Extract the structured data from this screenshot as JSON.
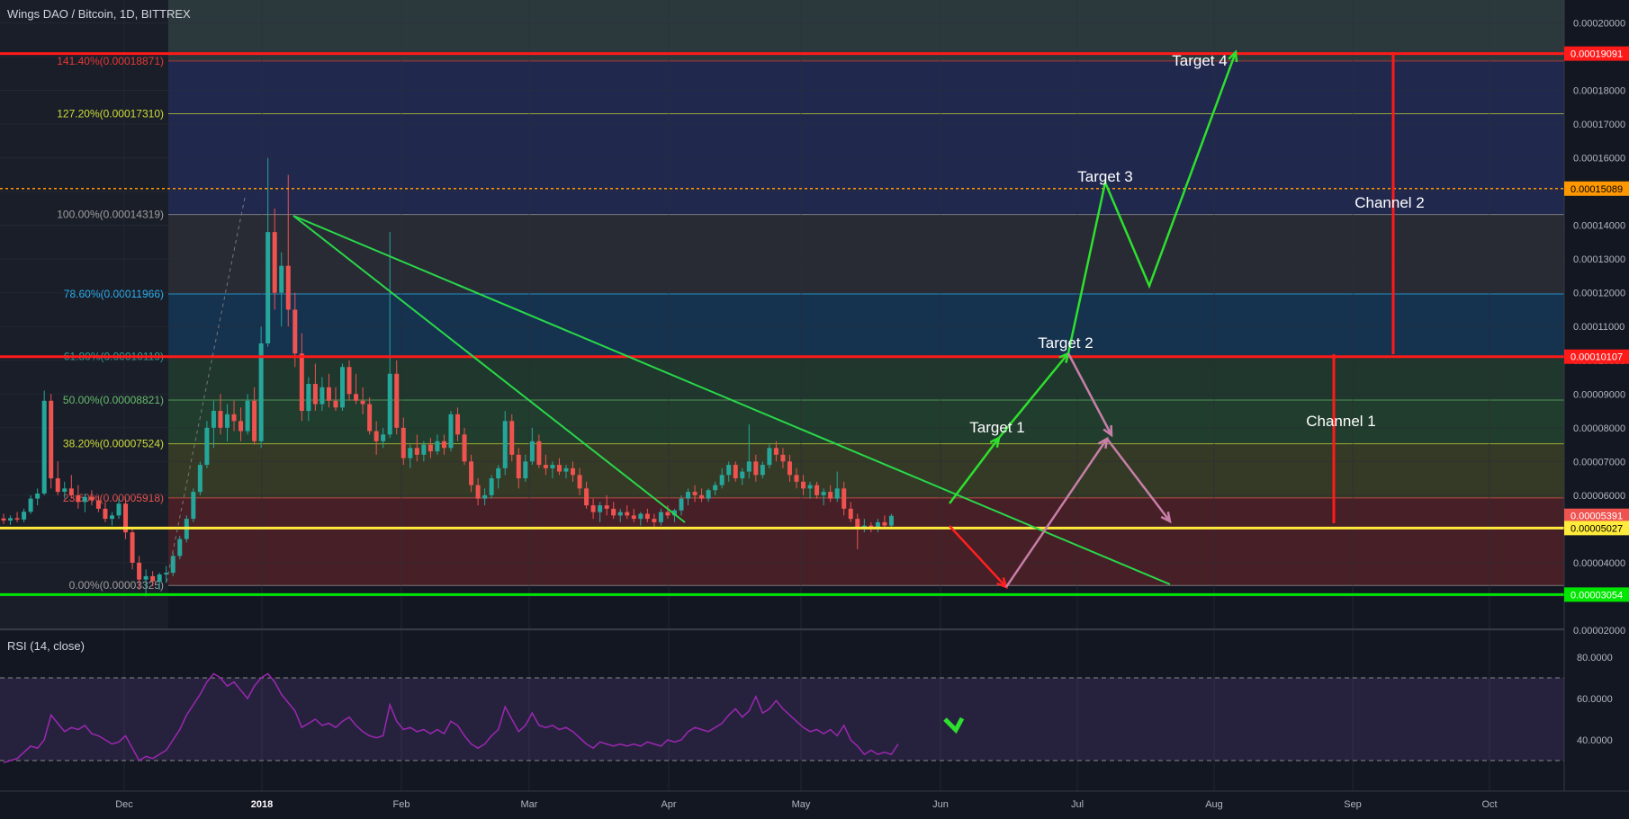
{
  "header": {
    "symbol_title": "Wings DAO / Bitcoin, 1D, BITTREX"
  },
  "rsi": {
    "label": "RSI (14, close)",
    "ticks": [
      "80.0000",
      "60.0000",
      "40.0000"
    ]
  },
  "colors": {
    "background": "#131722",
    "up": "#26a69a",
    "down": "#ef5350",
    "rsi_line": "#9c27b0"
  },
  "chart_data": {
    "type": "candlestick",
    "x_axis": {
      "tick_labels": [
        "Dec",
        "2018",
        "Feb",
        "Mar",
        "Apr",
        "May",
        "Jun",
        "Jul",
        "Aug",
        "Sep",
        "Oct"
      ]
    },
    "y_axis": {
      "tick_labels": [
        "0.00020000",
        "0.00019000",
        "0.00018000",
        "0.00017000",
        "0.00016000",
        "0.00015000",
        "0.00014000",
        "0.00013000",
        "0.00012000",
        "0.00011000",
        "0.00010000",
        "0.00009000",
        "0.00008000",
        "0.00007000",
        "0.00006000",
        "0.00005000",
        "0.00004000",
        "0.00003000",
        "0.00002000"
      ],
      "range": [
        2e-05,
        0.000202
      ],
      "price_labels": [
        {
          "text": "0.00019091",
          "value": 0.00019091,
          "color": "#ff1a1a"
        },
        {
          "text": "0.00015089",
          "value": 0.00015089,
          "color": "#ff9800"
        },
        {
          "text": "0.00010107",
          "value": 0.00010107,
          "color": "#ff1a1a"
        },
        {
          "text": "0.00005391",
          "value": 5.391e-05,
          "color": "#ef5350"
        },
        {
          "text": "0.00005027",
          "value": 5.027e-05,
          "color": "#ffeb3b"
        },
        {
          "text": "0.00003054",
          "value": 3.054e-05,
          "color": "#00e600"
        }
      ]
    },
    "fib_levels": [
      {
        "label": "141.40%(0.00018871)",
        "value": 0.00018871,
        "color": "#e53935"
      },
      {
        "label": "127.20%(0.00017310)",
        "value": 0.0001731,
        "color": "#cddc39"
      },
      {
        "label": "100.00%(0.00014319)",
        "value": 0.00014319,
        "color": "#9e9e9e"
      },
      {
        "label": "78.60%(0.00011966)",
        "value": 0.00011966,
        "color": "#29b6f6"
      },
      {
        "label": "61.80%(0.00010119)",
        "value": 0.00010119,
        "color": "#26a69a"
      },
      {
        "label": "50.00%(0.00008821)",
        "value": 8.821e-05,
        "color": "#66bb6a"
      },
      {
        "label": "38.20%(0.00007524)",
        "value": 7.524e-05,
        "color": "#cddc39"
      },
      {
        "label": "23.60%(0.00005918)",
        "value": 5.918e-05,
        "color": "#ef5350"
      },
      {
        "label": "0.00%(0.00003325)",
        "value": 3.325e-05,
        "color": "#9e9e9e"
      }
    ],
    "annotations": [
      "Target 1",
      "Target 2",
      "Target 3",
      "Target 4",
      "Channel 1",
      "Channel 2"
    ],
    "horizontal_lines": [
      {
        "value": 0.00019091,
        "color": "#ff1a1a"
      },
      {
        "value": 0.00015089,
        "color": "#ff9800",
        "style": "dashed"
      },
      {
        "value": 0.00010107,
        "color": "#ff1a1a"
      },
      {
        "value": 5.027e-05,
        "color": "#ffeb3b"
      },
      {
        "value": 3.054e-05,
        "color": "#00e600"
      }
    ],
    "candles": [
      [
        5.31e-05,
        5.45e-05,
        5.15e-05,
        5.25e-05
      ],
      [
        5.25e-05,
        5.4e-05,
        5.12e-05,
        5.32e-05
      ],
      [
        5.32e-05,
        5.5e-05,
        5.2e-05,
        5.28e-05
      ],
      [
        5.28e-05,
        5.6e-05,
        5.2e-05,
        5.51e-05
      ],
      [
        5.51e-05,
        6e-05,
        5.45e-05,
        5.9e-05
      ],
      [
        5.9e-05,
        6.2e-05,
        5.7e-05,
        6.05e-05
      ],
      [
        6.05e-05,
        9.1e-05,
        6e-05,
        8.8e-05
      ],
      [
        8.8e-05,
        9e-05,
        6.2e-05,
        6.5e-05
      ],
      [
        6.5e-05,
        7e-05,
        6e-05,
        6.1e-05
      ],
      [
        6.1e-05,
        6.4e-05,
        5.9e-05,
        6.2e-05
      ],
      [
        6.2e-05,
        6.6e-05,
        5.9e-05,
        6e-05
      ],
      [
        6e-05,
        6.3e-05,
        5.6e-05,
        5.8e-05
      ],
      [
        5.8e-05,
        6.05e-05,
        5.5e-05,
        5.95e-05
      ],
      [
        5.95e-05,
        6.15e-05,
        5.7e-05,
        5.85e-05
      ],
      [
        5.85e-05,
        6e-05,
        5.5e-05,
        5.6e-05
      ],
      [
        5.6e-05,
        5.8e-05,
        5.2e-05,
        5.3e-05
      ],
      [
        5.3e-05,
        5.5e-05,
        5.1e-05,
        5.4e-05
      ],
      [
        5.4e-05,
        5.9e-05,
        5.3e-05,
        5.75e-05
      ],
      [
        5.75e-05,
        5.9e-05,
        4.7e-05,
        4.9e-05
      ],
      [
        4.9e-05,
        5e-05,
        3.8e-05,
        4e-05
      ],
      [
        4e-05,
        4.2e-05,
        3.2e-05,
        3.5e-05
      ],
      [
        3.5e-05,
        3.8e-05,
        3e-05,
        3.6e-05
      ],
      [
        3.6e-05,
        3.75e-05,
        3.3e-05,
        3.45e-05
      ],
      [
        3.45e-05,
        3.7e-05,
        3.2e-05,
        3.65e-05
      ],
      [
        3.65e-05,
        3.9e-05,
        3.4e-05,
        3.7e-05
      ],
      [
        3.7e-05,
        4.3e-05,
        3.6e-05,
        4.2e-05
      ],
      [
        4.2e-05,
        4.8e-05,
        4.1e-05,
        4.7e-05
      ],
      [
        4.7e-05,
        5.4e-05,
        4.6e-05,
        5.3e-05
      ],
      [
        5.3e-05,
        6.2e-05,
        5.2e-05,
        6.1e-05
      ],
      [
        6.1e-05,
        7e-05,
        6e-05,
        6.9e-05
      ],
      [
        6.9e-05,
        8.2e-05,
        6.8e-05,
        8e-05
      ],
      [
        8e-05,
        8.8e-05,
        7.4e-05,
        8.5e-05
      ],
      [
        8.5e-05,
        9e-05,
        7.8e-05,
        8e-05
      ],
      [
        8e-05,
        8.7e-05,
        7.6e-05,
        8.4e-05
      ],
      [
        8.4e-05,
        8.8e-05,
        7.9e-05,
        8.2e-05
      ],
      [
        8.2e-05,
        8.6e-05,
        7.6e-05,
        7.9e-05
      ],
      [
        7.9e-05,
        9e-05,
        7.8e-05,
        8.8e-05
      ],
      [
        8.8e-05,
        9.2e-05,
        7.5e-05,
        7.6e-05
      ],
      [
        7.6e-05,
        0.00011,
        7.4e-05,
        0.000105
      ],
      [
        0.000105,
        0.00016,
        0.000104,
        0.000138
      ],
      [
        0.000138,
        0.000145,
        0.000115,
        0.00012
      ],
      [
        0.00012,
        0.000132,
        0.00011,
        0.000128
      ],
      [
        0.000128,
        0.000155,
        0.00011,
        0.000115
      ],
      [
        0.000115,
        0.00012,
        9.8e-05,
        0.000102
      ],
      [
        0.000102,
        0.000108,
        8.2e-05,
        8.5e-05
      ],
      [
        8.5e-05,
        9.5e-05,
        8.2e-05,
        9.3e-05
      ],
      [
        9.3e-05,
        9.9e-05,
        8.5e-05,
        8.7e-05
      ],
      [
        8.7e-05,
        9.5e-05,
        8.5e-05,
        9.2e-05
      ],
      [
        9.2e-05,
        9.6e-05,
        8.6e-05,
        8.8e-05
      ],
      [
        8.8e-05,
        9.2e-05,
        8.5e-05,
        8.6e-05
      ],
      [
        8.6e-05,
        9.9e-05,
        8.5e-05,
        9.8e-05
      ],
      [
        9.8e-05,
        0.0001,
        8.8e-05,
        9e-05
      ],
      [
        9e-05,
        9.6e-05,
        8.7e-05,
        8.8e-05
      ],
      [
        8.8e-05,
        9.2e-05,
        8.4e-05,
        8.7e-05
      ],
      [
        8.7e-05,
        8.9e-05,
        7.8e-05,
        7.9e-05
      ],
      [
        7.9e-05,
        8.2e-05,
        7.2e-05,
        7.6e-05
      ],
      [
        7.6e-05,
        8e-05,
        7.4e-05,
        7.8e-05
      ],
      [
        7.8e-05,
        0.000138,
        7.7e-05,
        9.6e-05
      ],
      [
        9.6e-05,
        0.0001,
        7.8e-05,
        8e-05
      ],
      [
        8e-05,
        8.3e-05,
        6.9e-05,
        7.1e-05
      ],
      [
        7.1e-05,
        7.5e-05,
        6.8e-05,
        7.4e-05
      ],
      [
        7.4e-05,
        7.8e-05,
        7e-05,
        7.2e-05
      ],
      [
        7.2e-05,
        7.6e-05,
        7e-05,
        7.5e-05
      ],
      [
        7.5e-05,
        7.7e-05,
        7.1e-05,
        7.3e-05
      ],
      [
        7.3e-05,
        7.8e-05,
        7.2e-05,
        7.6e-05
      ],
      [
        7.6e-05,
        7.8e-05,
        7.2e-05,
        7.4e-05
      ],
      [
        7.4e-05,
        8.5e-05,
        7.3e-05,
        8.4e-05
      ],
      [
        8.4e-05,
        8.6e-05,
        7.6e-05,
        7.8e-05
      ],
      [
        7.8e-05,
        8e-05,
        6.9e-05,
        7e-05
      ],
      [
        7e-05,
        7.2e-05,
        6.1e-05,
        6.3e-05
      ],
      [
        6.3e-05,
        6.5e-05,
        5.7e-05,
        5.9e-05
      ],
      [
        5.9e-05,
        6.2e-05,
        5.7e-05,
        6e-05
      ],
      [
        6e-05,
        6.6e-05,
        5.9e-05,
        6.5e-05
      ],
      [
        6.5e-05,
        6.9e-05,
        6.2e-05,
        6.8e-05
      ],
      [
        6.8e-05,
        8.5e-05,
        6.6e-05,
        8.2e-05
      ],
      [
        8.2e-05,
        8.4e-05,
        7e-05,
        7.2e-05
      ],
      [
        7.2e-05,
        7.4e-05,
        6.2e-05,
        6.5e-05
      ],
      [
        6.5e-05,
        7.2e-05,
        6.4e-05,
        7e-05
      ],
      [
        7e-05,
        8e-05,
        6.9e-05,
        7.6e-05
      ],
      [
        7.6e-05,
        7.8e-05,
        6.8e-05,
        6.9e-05
      ],
      [
        6.9e-05,
        7.2e-05,
        6.6e-05,
        6.8e-05
      ],
      [
        6.8e-05,
        7e-05,
        6.5e-05,
        6.9e-05
      ],
      [
        6.9e-05,
        7.1e-05,
        6.6e-05,
        6.7e-05
      ],
      [
        6.7e-05,
        6.9e-05,
        6.5e-05,
        6.8e-05
      ],
      [
        6.8e-05,
        7e-05,
        6.4e-05,
        6.6e-05
      ],
      [
        6.6e-05,
        6.8e-05,
        6e-05,
        6.2e-05
      ],
      [
        6.2e-05,
        6.4e-05,
        5.6e-05,
        5.7e-05
      ],
      [
        5.7e-05,
        5.9e-05,
        5.3e-05,
        5.5e-05
      ],
      [
        5.5e-05,
        5.8e-05,
        5.2e-05,
        5.7e-05
      ],
      [
        5.7e-05,
        6e-05,
        5.4e-05,
        5.6e-05
      ],
      [
        5.6e-05,
        5.8e-05,
        5.3e-05,
        5.4e-05
      ],
      [
        5.4e-05,
        5.6e-05,
        5.2e-05,
        5.5e-05
      ],
      [
        5.5e-05,
        5.7e-05,
        5.3e-05,
        5.4e-05
      ],
      [
        5.4e-05,
        5.6e-05,
        5.2e-05,
        5.3e-05
      ],
      [
        5.3e-05,
        5.5e-05,
        5.1e-05,
        5.45e-05
      ],
      [
        5.45e-05,
        5.6e-05,
        5.2e-05,
        5.3e-05
      ],
      [
        5.3e-05,
        5.45e-05,
        5.05e-05,
        5.2e-05
      ],
      [
        5.2e-05,
        5.6e-05,
        5.1e-05,
        5.5e-05
      ],
      [
        5.5e-05,
        5.7e-05,
        5.3e-05,
        5.4e-05
      ],
      [
        5.4e-05,
        5.6e-05,
        5.2e-05,
        5.55e-05
      ],
      [
        5.55e-05,
        6e-05,
        5.4e-05,
        5.9e-05
      ],
      [
        5.9e-05,
        6.2e-05,
        5.7e-05,
        6.1e-05
      ],
      [
        6.1e-05,
        6.3e-05,
        5.8e-05,
        6e-05
      ],
      [
        6e-05,
        6.2e-05,
        5.8e-05,
        5.9e-05
      ],
      [
        5.9e-05,
        6.2e-05,
        5.8e-05,
        6.15e-05
      ],
      [
        6.15e-05,
        6.4e-05,
        6e-05,
        6.3e-05
      ],
      [
        6.3e-05,
        6.8e-05,
        6.2e-05,
        6.6e-05
      ],
      [
        6.6e-05,
        7e-05,
        6.4e-05,
        6.9e-05
      ],
      [
        6.9e-05,
        7e-05,
        6.4e-05,
        6.5e-05
      ],
      [
        6.5e-05,
        6.8e-05,
        6.3e-05,
        6.7e-05
      ],
      [
        6.7e-05,
        8.1e-05,
        6.5e-05,
        7e-05
      ],
      [
        7e-05,
        7.2e-05,
        6.4e-05,
        6.6e-05
      ],
      [
        6.6e-05,
        7e-05,
        6.5e-05,
        6.9e-05
      ],
      [
        6.9e-05,
        7.5e-05,
        6.8e-05,
        7.4e-05
      ],
      [
        7.4e-05,
        7.6e-05,
        7e-05,
        7.2e-05
      ],
      [
        7.2e-05,
        7.4e-05,
        6.8e-05,
        7e-05
      ],
      [
        7e-05,
        7.2e-05,
        6.4e-05,
        6.6e-05
      ],
      [
        6.6e-05,
        6.8e-05,
        6.2e-05,
        6.4e-05
      ],
      [
        6.4e-05,
        6.6e-05,
        6e-05,
        6.2e-05
      ],
      [
        6.2e-05,
        6.4e-05,
        5.9e-05,
        6.3e-05
      ],
      [
        6.3e-05,
        6.4e-05,
        5.9e-05,
        6e-05
      ],
      [
        6e-05,
        6.2e-05,
        5.7e-05,
        6.1e-05
      ],
      [
        6.1e-05,
        6.3e-05,
        5.8e-05,
        5.9e-05
      ],
      [
        5.9e-05,
        6.7e-05,
        5.8e-05,
        6.2e-05
      ],
      [
        6.2e-05,
        6.4e-05,
        5.4e-05,
        5.6e-05
      ],
      [
        5.6e-05,
        5.8e-05,
        5.2e-05,
        5.3e-05
      ],
      [
        5.3e-05,
        5.45e-05,
        4.4e-05,
        5e-05
      ],
      [
        5e-05,
        5.3e-05,
        4.9e-05,
        5.1e-05
      ],
      [
        5.1e-05,
        5.2e-05,
        4.9e-05,
        5e-05
      ],
      [
        5e-05,
        5.3e-05,
        4.9e-05,
        5.2e-05
      ],
      [
        5.2e-05,
        5.4e-05,
        5e-05,
        5.1e-05
      ],
      [
        5.1e-05,
        5.45e-05,
        5e-05,
        5.39e-05
      ]
    ],
    "rsi_values": [
      29,
      30,
      31,
      34,
      37,
      36,
      40,
      52,
      48,
      44,
      46,
      45,
      47,
      43,
      42,
      40,
      38,
      39,
      42,
      36,
      30,
      32,
      31,
      33,
      35,
      40,
      45,
      52,
      57,
      62,
      68,
      72,
      70,
      66,
      68,
      64,
      60,
      66,
      70,
      72,
      68,
      62,
      58,
      54,
      46,
      48,
      50,
      47,
      48,
      46,
      49,
      51,
      47,
      44,
      42,
      41,
      42,
      57,
      49,
      45,
      46,
      44,
      45,
      43,
      45,
      43,
      49,
      47,
      42,
      38,
      36,
      38,
      42,
      45,
      56,
      50,
      44,
      47,
      53,
      47,
      46,
      47,
      45,
      46,
      44,
      41,
      38,
      36,
      39,
      38,
      37,
      38,
      37,
      38,
      37,
      39,
      38,
      37,
      40,
      39,
      40,
      44,
      46,
      45,
      44,
      46,
      48,
      52,
      55,
      51,
      54,
      61,
      53,
      55,
      59,
      55,
      52,
      49,
      46,
      44,
      45,
      43,
      45,
      42,
      47,
      40,
      37,
      33,
      35,
      33,
      34,
      33,
      38
    ],
    "rsi_range": [
      20,
      90
    ]
  }
}
